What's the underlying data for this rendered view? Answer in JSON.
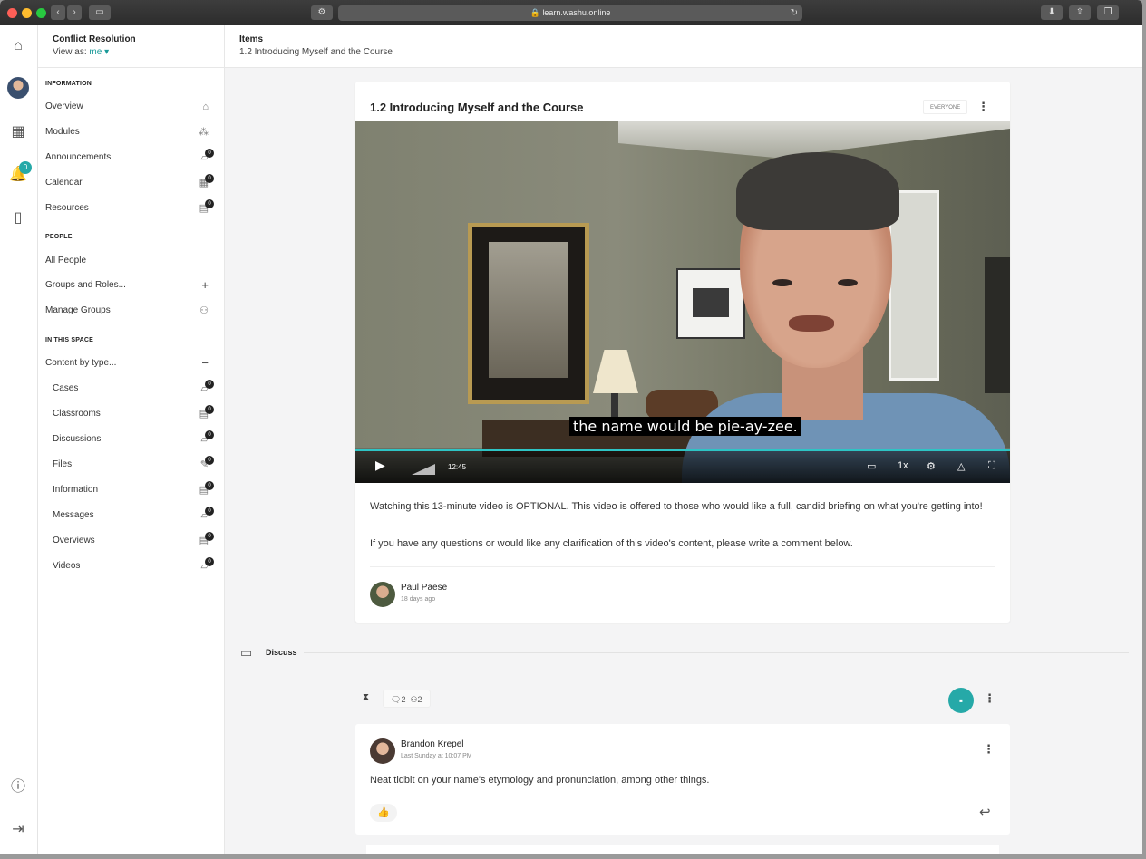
{
  "browser": {
    "url": "learn.washu.online",
    "lock_icon": "lock-icon"
  },
  "rail": {
    "notification_count": "0"
  },
  "sidebar": {
    "course_title": "Conflict Resolution",
    "view_as_label": "View as:",
    "view_as_value": "me ▾",
    "sections": {
      "information": "INFORMATION",
      "people": "PEOPLE",
      "in_this_space": "IN THIS SPACE"
    },
    "information_items": [
      {
        "label": "Overview"
      },
      {
        "label": "Modules"
      },
      {
        "label": "Announcements",
        "count": "0"
      },
      {
        "label": "Calendar",
        "count": "0"
      },
      {
        "label": "Resources",
        "count": "0"
      }
    ],
    "people_items": [
      {
        "label": "All People"
      },
      {
        "label": "Groups and Roles..."
      },
      {
        "label": "Manage Groups"
      }
    ],
    "content_by_type_label": "Content by type...",
    "content_items": [
      {
        "label": "Cases",
        "count": "0"
      },
      {
        "label": "Classrooms",
        "count": "0"
      },
      {
        "label": "Discussions",
        "count": "0"
      },
      {
        "label": "Files",
        "count": "0"
      },
      {
        "label": "Information",
        "count": "0"
      },
      {
        "label": "Messages",
        "count": "0"
      },
      {
        "label": "Overviews",
        "count": "0"
      },
      {
        "label": "Videos",
        "count": "0"
      }
    ]
  },
  "topbar": {
    "crumb": "Items",
    "subtitle": "1.2 Introducing Myself and the Course"
  },
  "card": {
    "title": "1.2 Introducing Myself and the Course",
    "audience_badge": "EVERYONE",
    "video": {
      "caption": "the name would be pie-ay-zee.",
      "time": "12:45",
      "speed": "1x",
      "progress": 1.0
    },
    "description": [
      "Watching this 13-minute video is OPTIONAL. This video is offered to those who would like a full, candid briefing on what you're getting into!",
      "If you have any questions or would like any clarification of this video's content, please write a comment below."
    ],
    "author": {
      "name": "Paul Paese",
      "time": "18 days ago"
    }
  },
  "discuss": {
    "label": "Discuss",
    "comment_count": "2",
    "participant_count": "2"
  },
  "comment": {
    "author": "Brandon Krepel",
    "time": "Last Sunday at 10:07 PM",
    "text": "Neat tidbit on your name's etymology and pronunciation, among other things."
  }
}
